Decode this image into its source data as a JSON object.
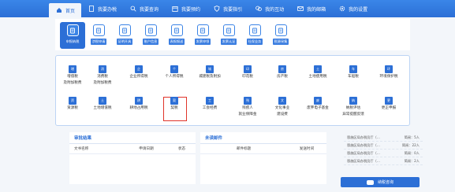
{
  "nav": {
    "items": [
      {
        "label": "首页",
        "icon": "home-icon"
      },
      {
        "label": "我要办税",
        "icon": "document-icon"
      },
      {
        "label": "我要查询",
        "icon": "search-icon"
      },
      {
        "label": "我要预约",
        "icon": "calendar-icon"
      },
      {
        "label": "我要指引",
        "icon": "shield-icon"
      },
      {
        "label": "我的互动",
        "icon": "chat-icon"
      },
      {
        "label": "我的邮箱",
        "icon": "mail-icon"
      },
      {
        "label": "我的设置",
        "icon": "gear-icon"
      }
    ]
  },
  "tabs": [
    {
      "label": "申报纳税"
    },
    {
      "label": "涉税申请"
    },
    {
      "label": "证明开具"
    },
    {
      "label": "账户信息"
    },
    {
      "label": "表报报送"
    },
    {
      "label": "发票申领"
    },
    {
      "label": "发票认证"
    },
    {
      "label": "社保业务"
    },
    {
      "label": "税源采集"
    }
  ],
  "taxes": {
    "row1": [
      {
        "label": "增值税",
        "sub": "及附加税费",
        "glyph": "增"
      },
      {
        "label": "消费税",
        "sub": "及附加税费",
        "glyph": "消"
      },
      {
        "label": "企业所得税",
        "sub": "",
        "glyph": "企"
      },
      {
        "label": "个人所得税",
        "sub": "",
        "glyph": "个"
      },
      {
        "label": "城建税及附加",
        "sub": "",
        "glyph": "城"
      },
      {
        "label": "印花税",
        "sub": "",
        "glyph": "印"
      },
      {
        "label": "房产税",
        "sub": "",
        "glyph": "房"
      },
      {
        "label": "土地使用税",
        "sub": "",
        "glyph": "土"
      },
      {
        "label": "车船税",
        "sub": "",
        "glyph": "车"
      },
      {
        "label": "环境保护税",
        "sub": "",
        "glyph": "环"
      }
    ],
    "row2": [
      {
        "label": "资源税",
        "sub": "",
        "glyph": "资"
      },
      {
        "label": "土地增值税",
        "sub": "",
        "glyph": "土"
      },
      {
        "label": "耕地占用税",
        "sub": "",
        "glyph": "耕"
      },
      {
        "label": "契税",
        "sub": "",
        "glyph": "契"
      },
      {
        "label": "工会经费",
        "sub": "",
        "glyph": "工"
      },
      {
        "label": "残疾人",
        "sub": "就业保障金",
        "glyph": "残"
      },
      {
        "label": "文化事业",
        "sub": "建设费",
        "glyph": "文"
      },
      {
        "label": "废弃电子基金",
        "sub": "",
        "glyph": "废"
      },
      {
        "label": "纳税评估",
        "sub": "异常提醒反馈",
        "glyph": "纳"
      },
      {
        "label": "更正申报",
        "sub": "",
        "glyph": "更"
      }
    ]
  },
  "review": {
    "title": "审批结果",
    "columns": [
      "文书名称",
      "申请日期",
      "状态"
    ]
  },
  "mail": {
    "title": "未读邮件",
    "columns": [
      "邮件标题",
      "发送时间"
    ]
  },
  "side_list": [
    {
      "text": "恩施区局办税员厅（…",
      "count": "简阅：5人"
    },
    {
      "text": "恩施区局办税员厅（…",
      "count": "简阅：22人"
    },
    {
      "text": "恩施区局办税员厅（…",
      "count": "简阅：0人"
    },
    {
      "text": "恩施区局办税员厅（…",
      "count": "简阅：2人"
    }
  ],
  "consult": {
    "label": "纳税咨询"
  },
  "colors": {
    "brand": "#2c6fd6",
    "highlight": "#e0342a"
  }
}
